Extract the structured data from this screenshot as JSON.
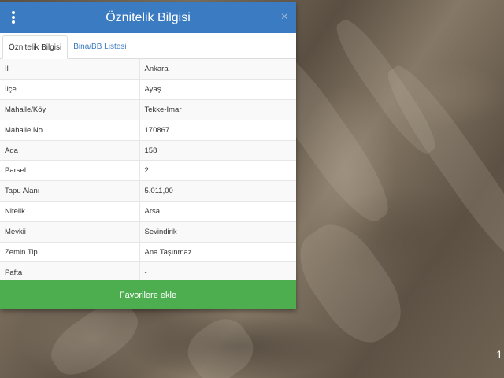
{
  "panel": {
    "title": "Öznitelik Bilgisi",
    "close_symbol": "×",
    "menu_icon": "vertical-dots-icon"
  },
  "tabs": [
    {
      "label": "Öznitelik Bilgisi",
      "active": true
    },
    {
      "label": "Bina/BB Listesi",
      "active": false
    }
  ],
  "attributes": [
    {
      "key": "İl",
      "value": "Ankara"
    },
    {
      "key": "İlçe",
      "value": "Ayaş"
    },
    {
      "key": "Mahalle/Köy",
      "value": "Tekke-İmar"
    },
    {
      "key": "Mahalle No",
      "value": "170867"
    },
    {
      "key": "Ada",
      "value": "158"
    },
    {
      "key": "Parsel",
      "value": "2"
    },
    {
      "key": "Tapu Alanı",
      "value": "5.011,00"
    },
    {
      "key": "Nitelik",
      "value": "Arsa"
    },
    {
      "key": "Mevkii",
      "value": "Sevindirik"
    },
    {
      "key": "Zemin Tip",
      "value": "Ana Taşınmaz"
    },
    {
      "key": "Pafta",
      "value": "-"
    }
  ],
  "actions": {
    "favorite_label": "Favorilere ekle"
  },
  "map": {
    "edge_text": "1"
  },
  "colors": {
    "header": "#3a7bc1",
    "favorite_button": "#4cae4f"
  }
}
